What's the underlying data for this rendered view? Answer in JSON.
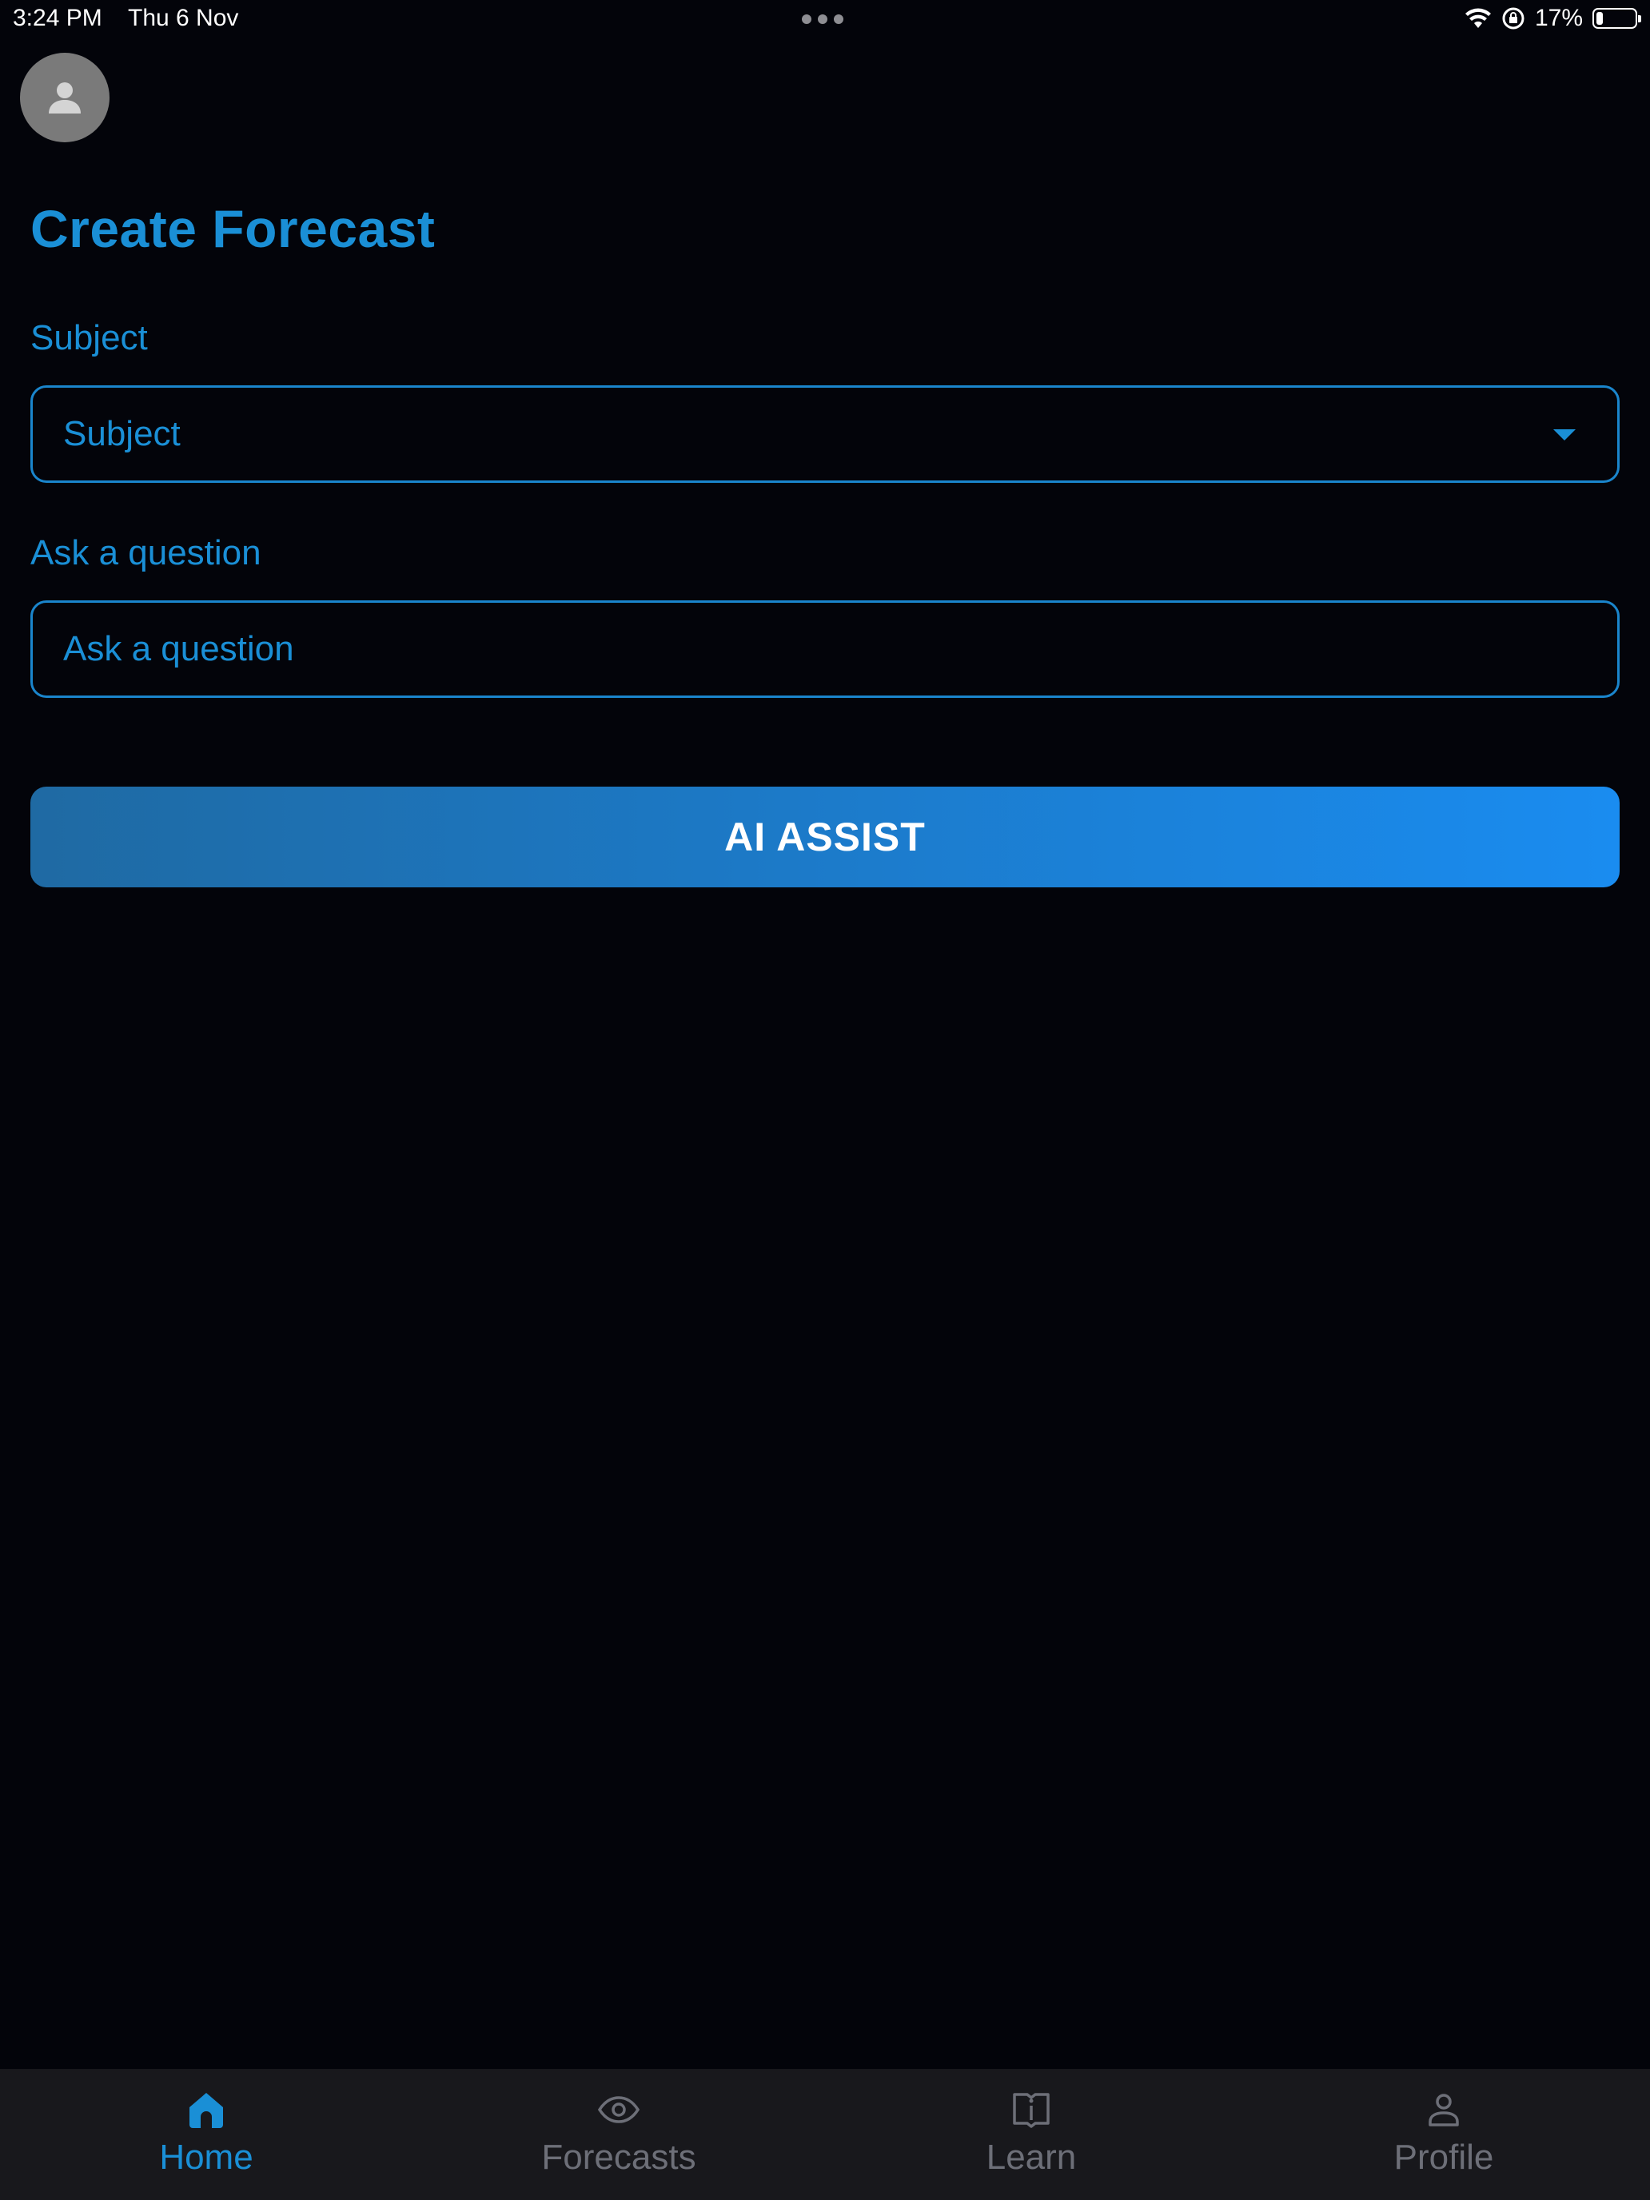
{
  "status_bar": {
    "time": "3:24 PM",
    "date": "Thu 6 Nov",
    "battery_percent": "17%",
    "battery_level": 0.17
  },
  "header": {
    "avatar_icon": "person-icon"
  },
  "page": {
    "title": "Create Forecast"
  },
  "form": {
    "subject_label": "Subject",
    "subject_value": "Subject",
    "question_label": "Ask a question",
    "question_placeholder": "Ask a question",
    "ai_assist_label": "AI ASSIST"
  },
  "tabs": [
    {
      "label": "Home",
      "icon": "home-icon",
      "active": true
    },
    {
      "label": "Forecasts",
      "icon": "eye-icon",
      "active": false
    },
    {
      "label": "Learn",
      "icon": "book-icon",
      "active": false
    },
    {
      "label": "Profile",
      "icon": "person-icon",
      "active": false
    }
  ],
  "colors": {
    "accent": "#1a8fd6",
    "background": "#03040a",
    "tab_bar": "#18181c",
    "inactive_tab": "#6d6f78"
  }
}
